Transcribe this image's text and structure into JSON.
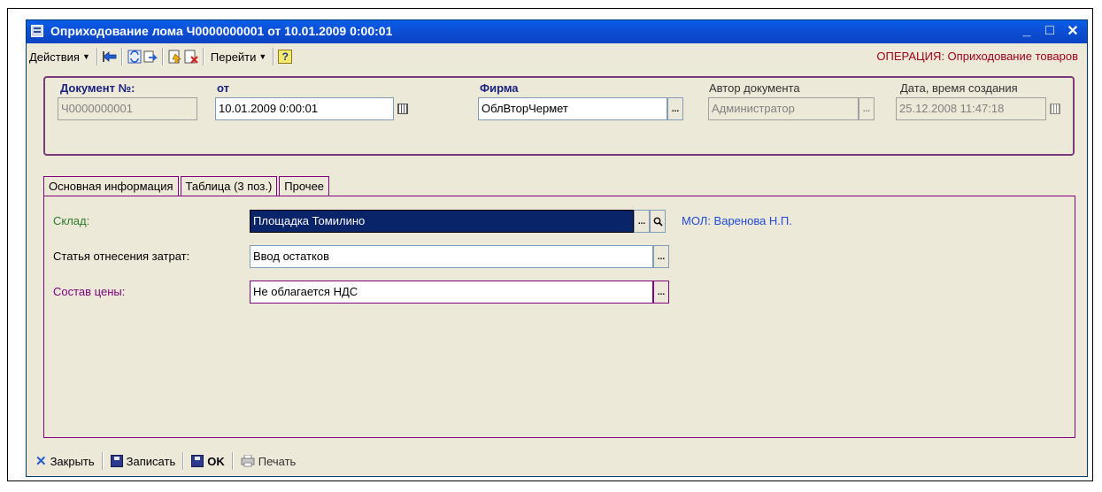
{
  "window": {
    "title": "Оприходование лома Ч0000000001 от 10.01.2009 0:00:01",
    "buttons": {
      "minimize": "_",
      "maximize": "□",
      "close": "✕"
    }
  },
  "toolbar": {
    "actions_label": "Действия",
    "goto_label": "Перейти",
    "help_label": "?",
    "operation_label": "ОПЕРАЦИЯ: Оприходование товаров",
    "icons": [
      "back-arrow-icon",
      "refresh-icon",
      "sync-icon",
      "document-up-icon",
      "document-delete-icon"
    ]
  },
  "header": {
    "doc_number_label": "Документ №:",
    "doc_number_value": "Ч0000000001",
    "date_label": "от",
    "date_value": "10.01.2009  0:00:01",
    "firm_label": "Фирма",
    "firm_value": "ОблВторЧермет",
    "author_label": "Автор документа",
    "author_value": "Администратор",
    "created_label": "Дата, время создания",
    "created_value": "25.12.2008 11:47:18",
    "button_dots": "..."
  },
  "tabs": [
    {
      "label": "Основная информация",
      "active": true
    },
    {
      "label": "Таблица (3 поз.)",
      "active": false
    },
    {
      "label": "Прочее",
      "active": false
    }
  ],
  "main": {
    "warehouse_label": "Склад:",
    "warehouse_value": "Площадка Томилино",
    "mol_text": "МОЛ: Варенова Н.П.",
    "cost_item_label": "Статья отнесения затрат:",
    "cost_item_value": "Ввод остатков",
    "price_label": "Состав цены:",
    "price_value": "Не облагается НДС"
  },
  "bottom": {
    "close_label": "Закрыть",
    "save_label": "Записать",
    "ok_label": "OK",
    "print_label": "Печать"
  },
  "colors": {
    "title_bar": "#0a4fd6",
    "operation_text": "#a0001e",
    "frame_purple": "#800080",
    "selection_navy": "#0a246a",
    "mol_blue": "#1f4bd6"
  }
}
